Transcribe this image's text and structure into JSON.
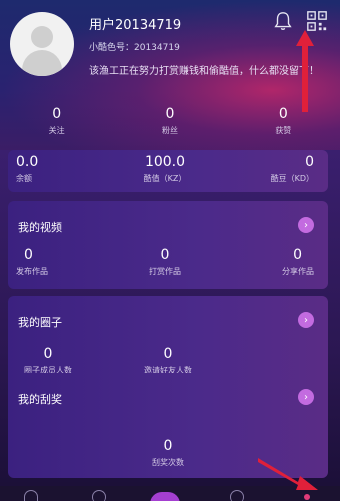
{
  "profile": {
    "username": "用户20134719",
    "account_id": "小酷色号：20134719",
    "signature": "该渔工正在努力打赏赚钱和偷酷值，什么都没留下！"
  },
  "stats": [
    {
      "value": "0",
      "label": "关注"
    },
    {
      "value": "0",
      "label": "粉丝"
    },
    {
      "value": "0",
      "label": "获赞"
    }
  ],
  "wallet": [
    {
      "value": "0.0",
      "label": "余额"
    },
    {
      "value": "100.0",
      "label": "酷值（KZ）"
    },
    {
      "value": "0",
      "label": "酷豆（KD）"
    }
  ],
  "sections": {
    "videos": {
      "title": "我的视频",
      "items": [
        {
          "value": "0",
          "label": "发布作品"
        },
        {
          "value": "0",
          "label": "打赏作品"
        },
        {
          "value": "0",
          "label": "分享作品"
        }
      ]
    },
    "circles": {
      "title": "我的圈子",
      "items": [
        {
          "value": "0",
          "label": "圈子成员人数"
        },
        {
          "value": "0",
          "label": "邀请好友人数"
        }
      ]
    },
    "lottery": {
      "title": "我的刮奖",
      "items": [
        {
          "value": "0",
          "label": "刮奖次数"
        }
      ]
    }
  },
  "icons": {
    "bell": "bell-icon",
    "qr": "qr-code-icon",
    "chevron": "chevron-right-icon"
  },
  "colors": {
    "accent": "#c36be0",
    "annotation_arrow": "#e0203a"
  }
}
